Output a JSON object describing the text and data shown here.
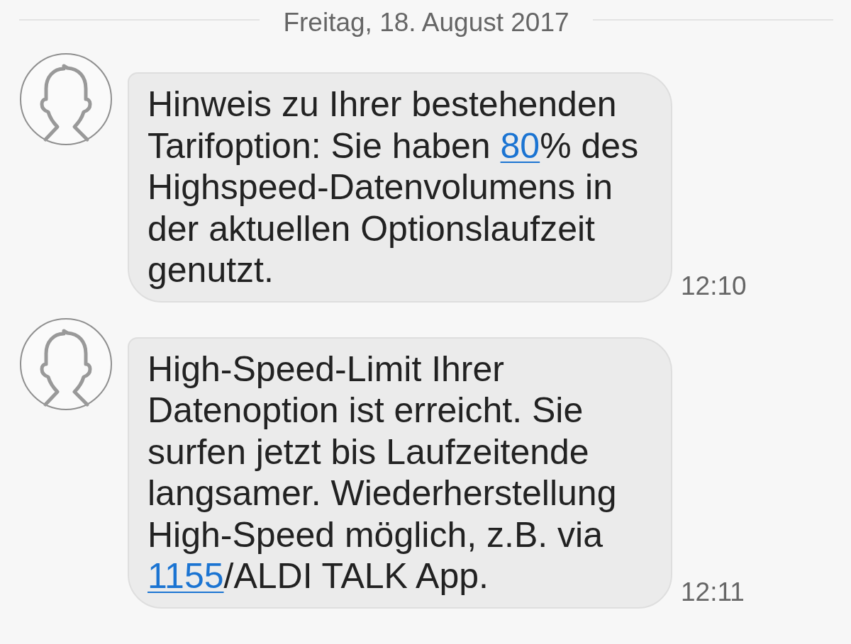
{
  "date_header": "Freitag, 18. August 2017",
  "messages": [
    {
      "body": [
        {
          "kind": "text",
          "text": "Hinweis zu Ihrer bestehenden Tarifoption: Sie haben "
        },
        {
          "kind": "link",
          "text": "80"
        },
        {
          "kind": "text",
          "text": "% des Highspeed-Datenvolumens in der aktuellen Optionslaufzeit genutzt."
        }
      ],
      "time": "12:10"
    },
    {
      "body": [
        {
          "kind": "text",
          "text": "High-Speed-Limit Ihrer Datenoption ist erreicht. Sie surfen jetzt bis Laufzeitende langsamer. Wiederherstellung High-Speed möglich, z.B. via "
        },
        {
          "kind": "link",
          "text": "1155"
        },
        {
          "kind": "text",
          "text": "/ALDI TALK App."
        }
      ],
      "time": "12:11"
    }
  ]
}
